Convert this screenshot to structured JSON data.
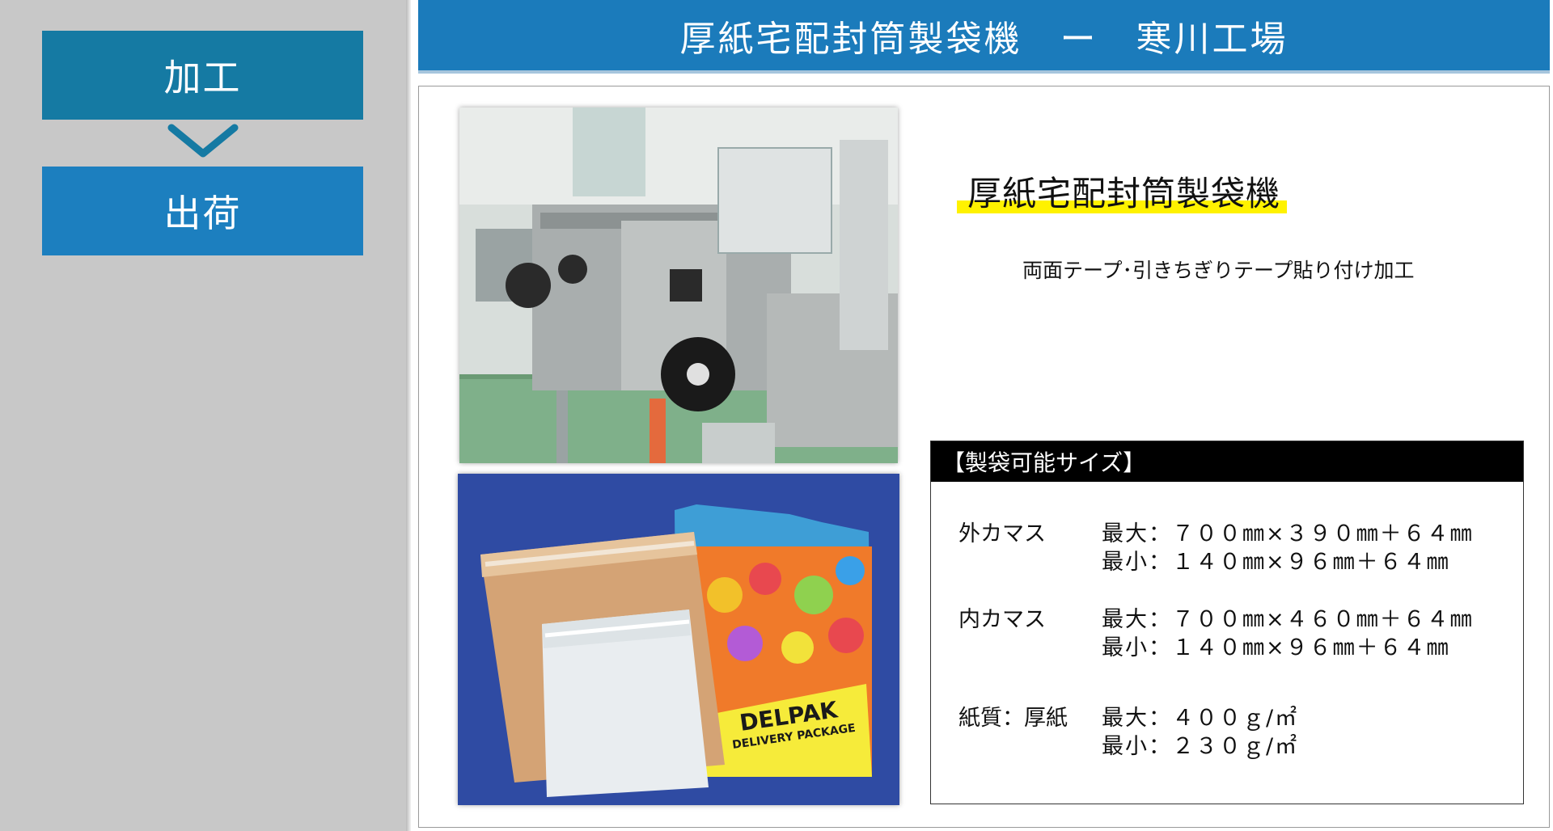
{
  "sidebar": {
    "steps": [
      {
        "label": "加工"
      },
      {
        "label": "出荷"
      }
    ]
  },
  "header": {
    "title": "厚紙宅配封筒製袋機　ー　寒川工場"
  },
  "machine": {
    "title": "厚紙宅配封筒製袋機",
    "description": "両面テープ･引きちぎりテープ貼り付け加工",
    "envelope_brand": "DELPAK",
    "envelope_tagline": "DELIVERY PACKAGE"
  },
  "specs": {
    "header": "【製袋可能サイズ】",
    "groups": [
      {
        "label": "外カマス",
        "rows": [
          "最大：７００㎜×３９０㎜＋６４㎜",
          "最小：１４０㎜×９６㎜＋６４㎜"
        ]
      },
      {
        "label": "内カマス",
        "rows": [
          "最大：７００㎜×４６０㎜＋６４㎜",
          "最小：１４０㎜×９６㎜＋６４㎜"
        ]
      },
      {
        "label": "紙質：厚紙",
        "rows": [
          "最大：４００ｇ/㎡",
          "最小：２３０ｇ/㎡"
        ]
      }
    ]
  },
  "colors": {
    "title_bar": "#1b7bbb",
    "step_active": "#157aa3",
    "step_next": "#1c7fbf",
    "sidebar_bg": "#c8c8c8",
    "highlight": "#fff200"
  }
}
